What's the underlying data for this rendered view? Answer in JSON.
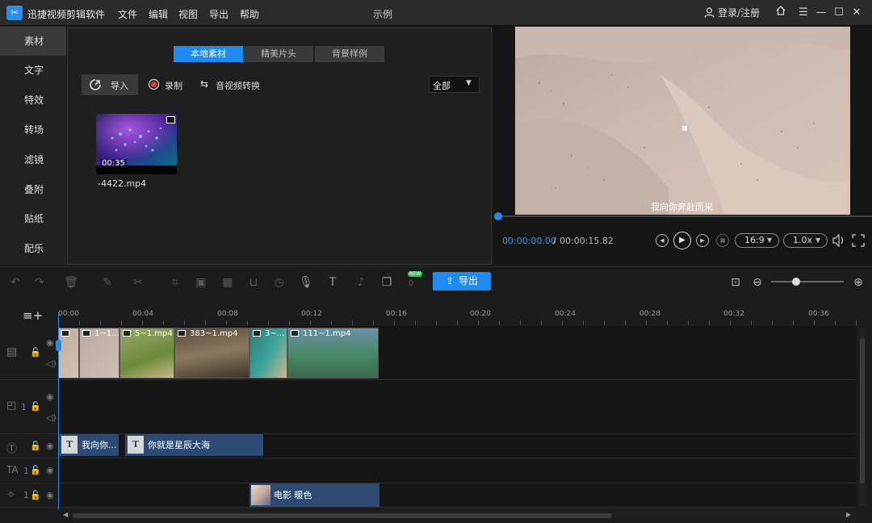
{
  "title_bar": {
    "app_name": "迅捷视频剪辑软件",
    "menus": [
      "文件",
      "编辑",
      "视图",
      "导出",
      "帮助"
    ],
    "project_name": "示例",
    "login_label": "登录/注册"
  },
  "sidebar": {
    "items": [
      {
        "label": "素材",
        "active": true
      },
      {
        "label": "文字"
      },
      {
        "label": "特效"
      },
      {
        "label": "转场"
      },
      {
        "label": "滤镜"
      },
      {
        "label": "叠附"
      },
      {
        "label": "贴纸"
      },
      {
        "label": "配乐"
      }
    ]
  },
  "media_panel": {
    "tabs": [
      {
        "label": "本地素材",
        "active": true
      },
      {
        "label": "精美片头"
      },
      {
        "label": "背景样例"
      }
    ],
    "import_label": "导入",
    "record_label": "录制",
    "convert_label": "音视频转换",
    "filter_value": "全部",
    "files": [
      {
        "name": "-4422.mp4",
        "duration": "00:35"
      }
    ]
  },
  "preview": {
    "subtitle": "我向你奔赴而来",
    "current_time": "00:00:00.00",
    "separator": "/",
    "total_time": "00:00:15.82",
    "aspect_ratio": "16:9",
    "speed": "1.0x",
    "progress_fraction": 0.0
  },
  "toolbar": {
    "export_label": "导出",
    "new_badge": "NEW"
  },
  "timeline": {
    "ruler_ticks": [
      "00:00",
      "00:04",
      "00:08",
      "00:12",
      "00:16",
      "00:20",
      "00:24",
      "00:28",
      "00:32",
      "00:36"
    ],
    "video_clips": [
      "1~1...",
      "5~1.mp4",
      "383~1.mp4",
      "3~...",
      "111~1.mp4"
    ],
    "pip_number": "1",
    "text_clips": [
      "我向你...",
      "你就是星辰大海"
    ],
    "subtitle_number": "1",
    "effect_number": "1",
    "effect_clip": "电影 暖色"
  }
}
